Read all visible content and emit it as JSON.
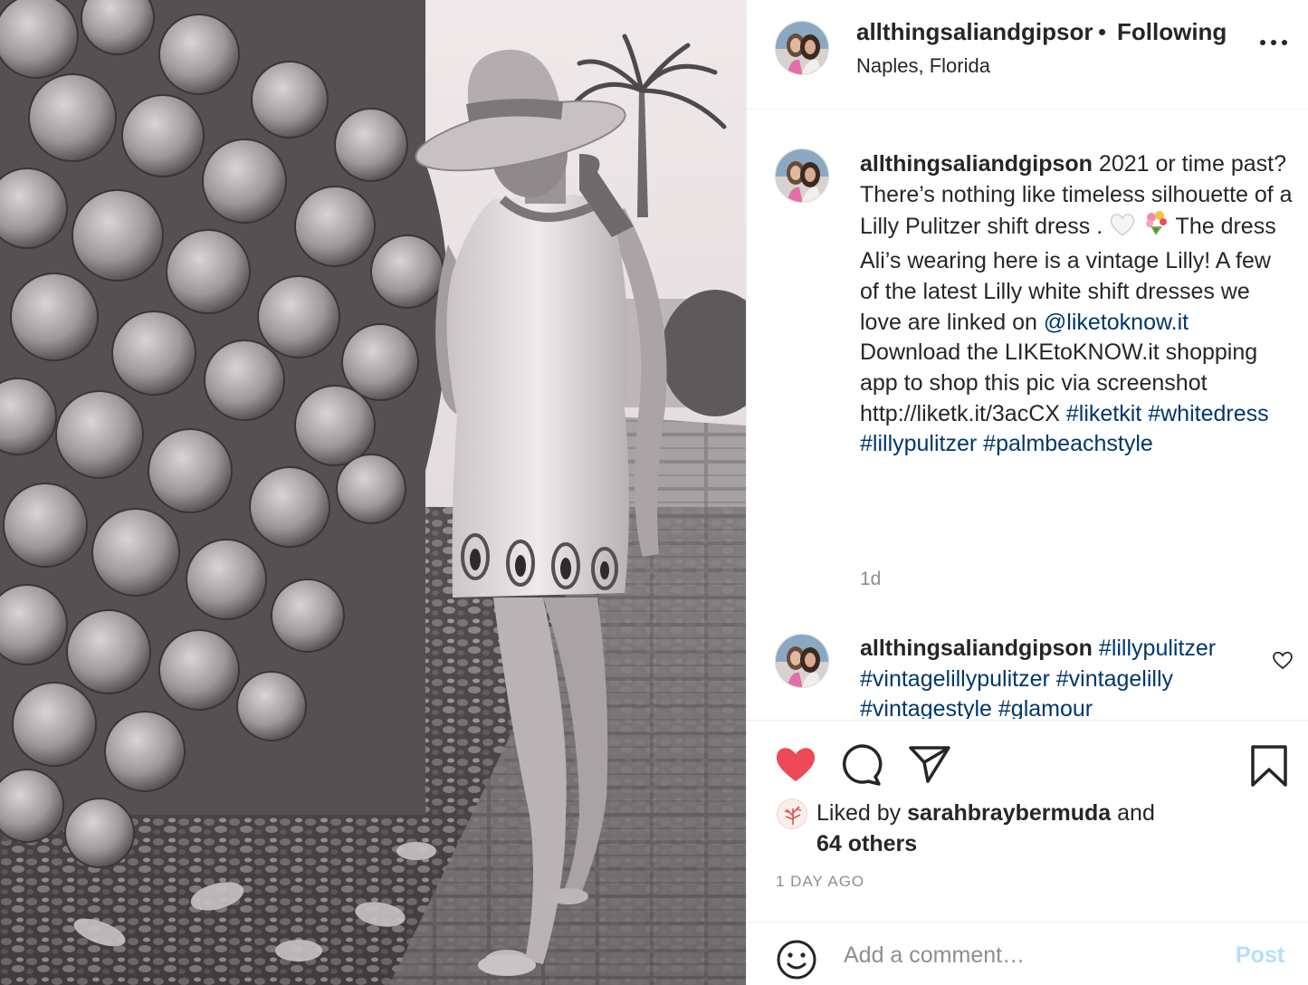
{
  "post": {
    "author": "allthingsaliandgipson",
    "author_truncated": "allthingsaliandgipsor",
    "separator": "•",
    "follow_status": "Following",
    "location": "Naples, Florida"
  },
  "caption": {
    "username": "allthingsaliandgipson",
    "text_1": "2021 or time past?",
    "text_2": "There’s nothing like timeless silhouette of a Lilly Pulitzer shift dress .",
    "text_3": "The dress Ali’s wearing here is a vintage Lilly! A few of the latest Lilly white shift dresses we love are linked on",
    "mention": "@liketoknow.it",
    "text_4": "Download the LIKEtoKNOW.it shopping app to shop this pic via screenshot http://liketk.it/3acCX",
    "hashtags": [
      "#liketkit",
      "#whitedress",
      "#lillypulitzer",
      "#palmbeachstyle"
    ],
    "emojis": [
      "white-heart",
      "bouquet"
    ],
    "time": "1d"
  },
  "comment": {
    "username": "allthingsaliandgipson",
    "hashtags": [
      "#lillypulitzer",
      "#vintagelillypulitzer",
      "#vintagelilly",
      "#vintagestyle",
      "#glamour"
    ]
  },
  "actions": {
    "liked_prefix": "Liked by",
    "liked_user": "sarahbraybermuda",
    "liked_and": "and",
    "liked_others": "64 others",
    "time_ago": "1 DAY AGO",
    "add_comment_placeholder": "Add a comment…",
    "post_label": "Post"
  },
  "colors": {
    "like_red": "#ed4956",
    "link_blue": "#00376b",
    "post_disabled": "#b2dffc",
    "muted": "#8e8e8e"
  },
  "icons": [
    "more-icon",
    "heart-icon",
    "comment-icon",
    "share-icon",
    "bookmark-icon",
    "comment-like-icon",
    "smiley-icon"
  ]
}
